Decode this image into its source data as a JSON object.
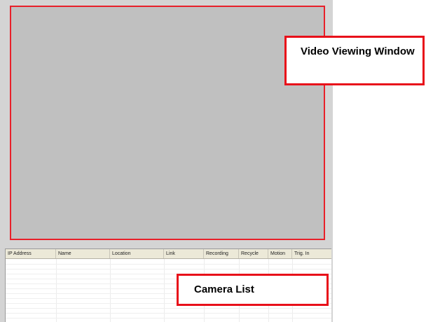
{
  "colors": {
    "annotation_border": "#e8101a",
    "video_background": "#c0c0c0",
    "app_background": "#d4d4d4",
    "header_background": "#ece9d8"
  },
  "callouts": {
    "video_window": "Video Viewing Window",
    "camera_list": "Camera List"
  },
  "camera_list": {
    "columns": [
      "IP Address",
      "Name",
      "Location",
      "Link",
      "Recording",
      "Recycle",
      "Motion",
      "Trig. In"
    ],
    "rows": []
  }
}
